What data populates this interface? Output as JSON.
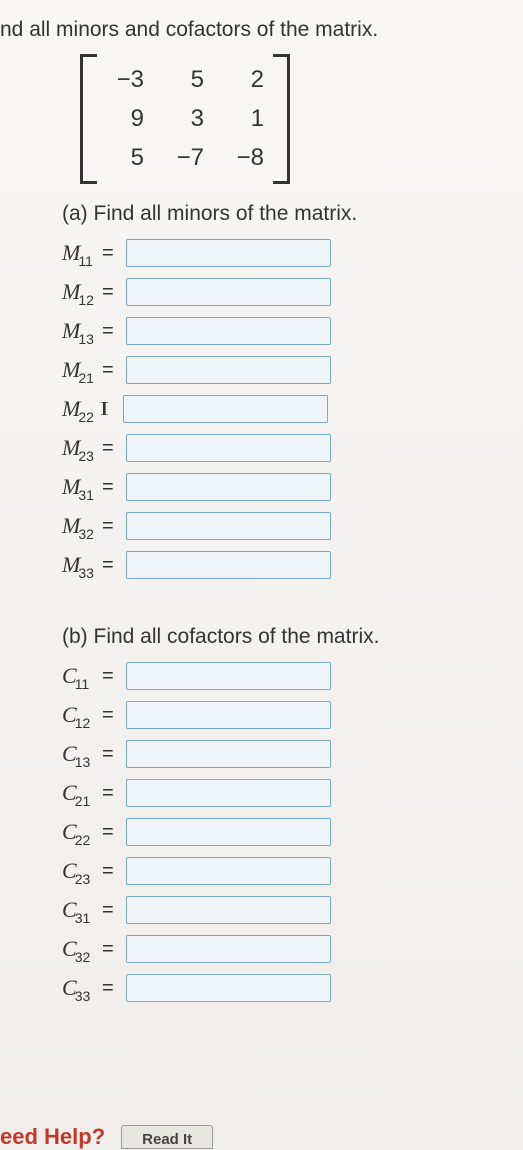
{
  "prompt": "nd all minors and cofactors of the matrix.",
  "matrix": {
    "r1c1": "−3",
    "r1c2": "5",
    "r1c3": "2",
    "r2c1": "9",
    "r2c2": "3",
    "r2c3": "1",
    "r3c1": "5",
    "r3c2": "−7",
    "r3c3": "−8"
  },
  "sectionA": {
    "label": "(a) Find all minors of the matrix.",
    "items": [
      {
        "var": "M",
        "sub": "11",
        "eq": "="
      },
      {
        "var": "M",
        "sub": "12",
        "eq": "="
      },
      {
        "var": "M",
        "sub": "13",
        "eq": "="
      },
      {
        "var": "M",
        "sub": "21",
        "eq": "="
      },
      {
        "var": "M",
        "sub": "22",
        "eq": "",
        "cursor": true
      },
      {
        "var": "M",
        "sub": "23",
        "eq": "="
      },
      {
        "var": "M",
        "sub": "31",
        "eq": "="
      },
      {
        "var": "M",
        "sub": "32",
        "eq": "="
      },
      {
        "var": "M",
        "sub": "33",
        "eq": "="
      }
    ]
  },
  "sectionB": {
    "label": "(b) Find all cofactors of the matrix.",
    "items": [
      {
        "var": "C",
        "sub": "11",
        "eq": "="
      },
      {
        "var": "C",
        "sub": "12",
        "eq": "="
      },
      {
        "var": "C",
        "sub": "13",
        "eq": "="
      },
      {
        "var": "C",
        "sub": "21",
        "eq": "="
      },
      {
        "var": "C",
        "sub": "22",
        "eq": "="
      },
      {
        "var": "C",
        "sub": "23",
        "eq": "="
      },
      {
        "var": "C",
        "sub": "31",
        "eq": "="
      },
      {
        "var": "C",
        "sub": "32",
        "eq": "="
      },
      {
        "var": "C",
        "sub": "33",
        "eq": "="
      }
    ]
  },
  "footer": {
    "needHelp": "eed Help?",
    "readIt": "Read It"
  }
}
